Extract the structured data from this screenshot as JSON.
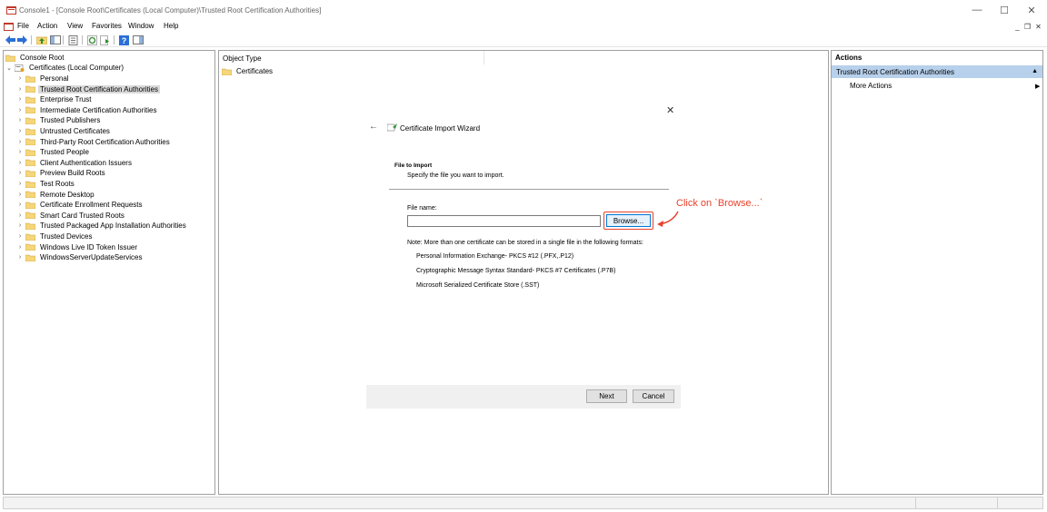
{
  "window": {
    "title": "Console1 - [Console Root\\Certificates (Local Computer)\\Trusted Root Certification Authorities]",
    "minimize": "—",
    "maximize": "☐",
    "close": "✕",
    "mdi_minimize": "_",
    "mdi_restore": "❐",
    "mdi_close": "✕"
  },
  "menu": {
    "items": [
      "File",
      "Action",
      "View",
      "Favorites",
      "Window",
      "Help"
    ]
  },
  "toolbar": {
    "buttons": [
      "back-arrow-icon",
      "forward-arrow-icon",
      "up-folder-icon",
      "show-hide-tree-icon",
      "properties-icon",
      "refresh-icon",
      "export-list-icon",
      "help-icon",
      "show-hide-action-pane-icon"
    ]
  },
  "tree": {
    "root": "Console Root",
    "certificates": "Certificates (Local Computer)",
    "stores": [
      "Personal",
      "Trusted Root Certification Authorities",
      "Enterprise Trust",
      "Intermediate Certification Authorities",
      "Trusted Publishers",
      "Untrusted Certificates",
      "Third-Party Root Certification Authorities",
      "Trusted People",
      "Client Authentication Issuers",
      "Preview Build Roots",
      "Test Roots",
      "Remote Desktop",
      "Certificate Enrollment Requests",
      "Smart Card Trusted Roots",
      "Trusted Packaged App Installation Authorities",
      "Trusted Devices",
      "Windows Live ID Token Issuer",
      "WindowsServerUpdateServices"
    ],
    "selected_index": 1
  },
  "content": {
    "column_header": "Object Type",
    "rows": [
      "Certificates"
    ]
  },
  "wizard": {
    "title": "Certificate Import Wizard",
    "back_glyph": "←",
    "close_glyph": "✕",
    "section_title": "File to Import",
    "section_subtitle": "Specify the file you want to import.",
    "file_name_label": "File name:",
    "file_name_value": "",
    "browse_label": "Browse...",
    "note": "Note:  More than one certificate can be stored in a single file in the following formats:",
    "formats": [
      "Personal Information Exchange- PKCS #12 (.PFX,.P12)",
      "Cryptographic Message Syntax Standard- PKCS #7 Certificates (.P7B)",
      "Microsoft Serialized Certificate Store (.SST)"
    ],
    "next_label": "Next",
    "cancel_label": "Cancel"
  },
  "annotation": {
    "text": "Click on `Browse...`",
    "color": "#e8412c"
  },
  "actions": {
    "header": "Actions",
    "section": "Trusted Root Certification Authorities",
    "section_arrow": "▲",
    "item": "More Actions",
    "item_arrow": "▶"
  },
  "colors": {
    "selection": "#d9d9d9",
    "actions_section": "#b7d0eb",
    "folder": "#f5d67a",
    "accent": "#0078d7"
  }
}
